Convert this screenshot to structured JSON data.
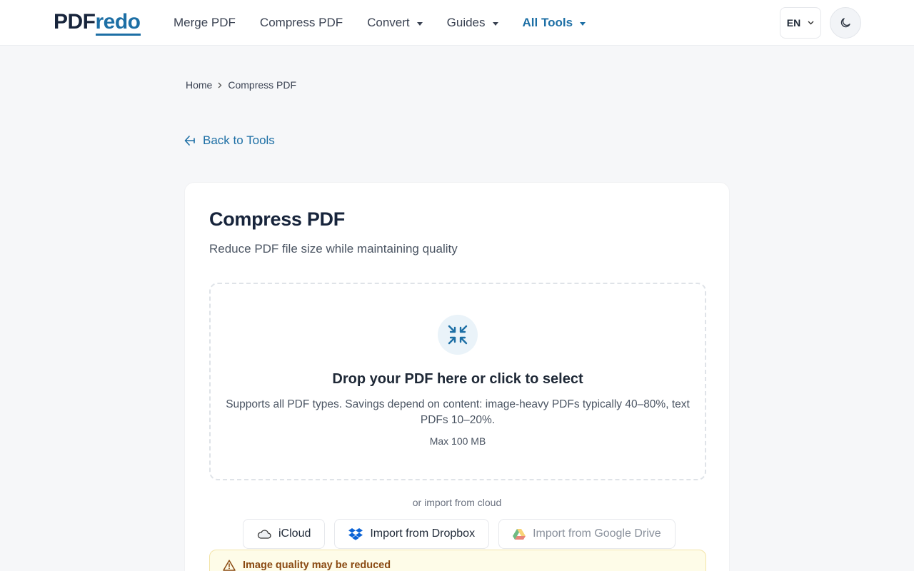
{
  "header": {
    "logo_main": "PDF",
    "logo_accent": "redo",
    "nav": {
      "merge": "Merge PDF",
      "compress": "Compress PDF",
      "convert": "Convert",
      "guides": "Guides",
      "all_tools": "All Tools"
    },
    "language": "EN"
  },
  "breadcrumb": {
    "home": "Home",
    "current": "Compress PDF"
  },
  "back_link": "Back to Tools",
  "tool": {
    "title": "Compress PDF",
    "subtitle": "Reduce PDF file size while maintaining quality",
    "dropzone": {
      "title": "Drop your PDF here or click to select",
      "description": "Supports all PDF types. Savings depend on content: image-heavy PDFs typically 40–80%, text PDFs 10–20%.",
      "max_size": "Max 100 MB"
    },
    "cloud": {
      "label": "or import from cloud",
      "icloud": "iCloud",
      "dropbox": "Import from Dropbox",
      "google_drive": "Import from Google Drive"
    },
    "warning": {
      "title": "Image quality may be reduced"
    }
  },
  "colors": {
    "accent": "#1d6fa5",
    "navy": "#17243b",
    "warning_bg": "#fefce8",
    "warning_text": "#8a4a12"
  },
  "icons": {
    "theme": "moon-icon",
    "back": "arrow-left-icon",
    "dropzone": "compress-arrows-icon",
    "icloud": "cloud-icon",
    "dropbox": "dropbox-icon",
    "google_drive": "google-drive-icon",
    "warning": "warning-triangle-icon"
  }
}
